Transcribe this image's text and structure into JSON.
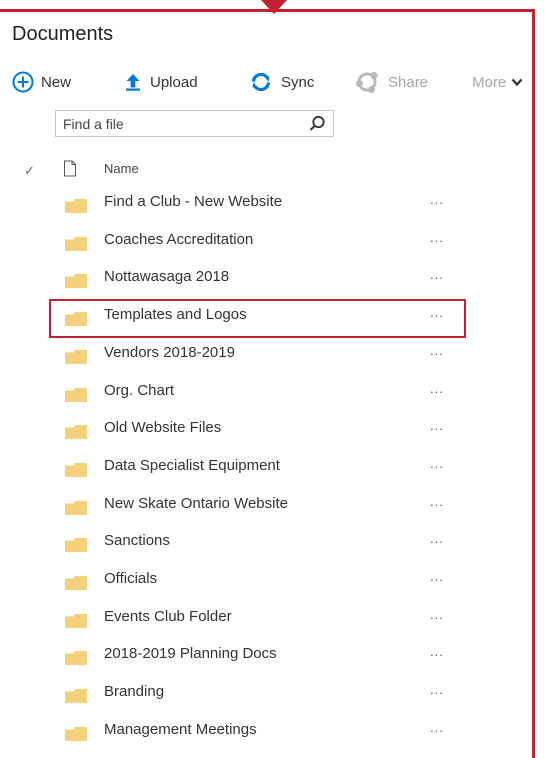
{
  "library": {
    "title": "Documents"
  },
  "toolbar": {
    "new_label": "New",
    "upload_label": "Upload",
    "sync_label": "Sync",
    "share_label": "Share",
    "more_label": "More"
  },
  "search": {
    "placeholder": "Find a file"
  },
  "columns": {
    "name": "Name"
  },
  "colors": {
    "accent": "#c32030",
    "folder": "#f3d07c",
    "brand_blue": "#0078d7"
  },
  "icons": {
    "new": "plus-circle-icon",
    "upload": "upload-arrow-icon",
    "sync": "sync-icon",
    "share": "share-icon",
    "more": "chevron-down-icon",
    "search": "search-icon",
    "row": "folder-icon"
  },
  "files": [
    {
      "name": "Find a Club - New Website",
      "menu": "..."
    },
    {
      "name": "Coaches Accreditation",
      "menu": "..."
    },
    {
      "name": "Nottawasaga 2018",
      "menu": "..."
    },
    {
      "name": "Templates and Logos",
      "menu": "..."
    },
    {
      "name": "Vendors 2018-2019",
      "menu": "..."
    },
    {
      "name": "Org. Chart",
      "menu": "..."
    },
    {
      "name": "Old Website Files",
      "menu": "..."
    },
    {
      "name": "Data Specialist Equipment",
      "menu": "..."
    },
    {
      "name": "New Skate Ontario Website",
      "menu": "..."
    },
    {
      "name": "Sanctions",
      "menu": "..."
    },
    {
      "name": "Officials",
      "menu": "..."
    },
    {
      "name": "Events Club Folder",
      "menu": "..."
    },
    {
      "name": "2018-2019 Planning Docs",
      "menu": "..."
    },
    {
      "name": "Branding",
      "menu": "..."
    },
    {
      "name": "Management Meetings",
      "menu": "..."
    }
  ]
}
